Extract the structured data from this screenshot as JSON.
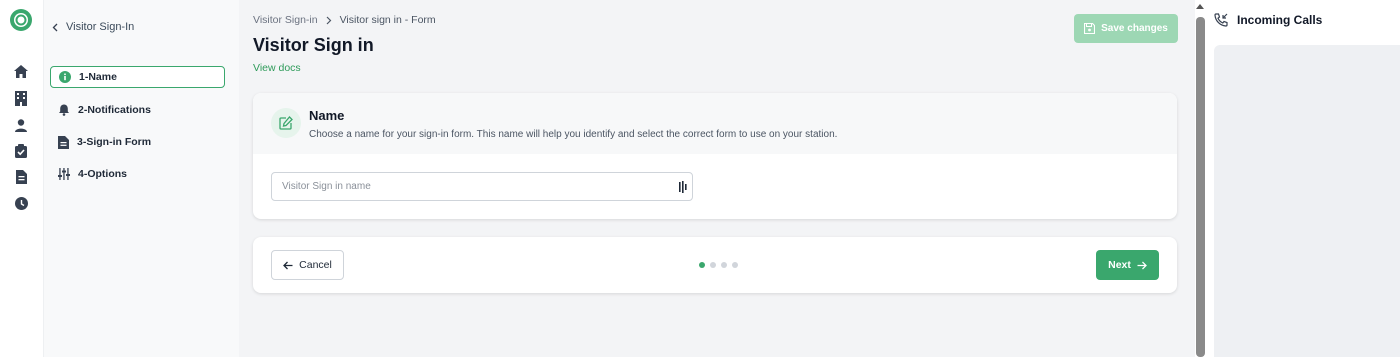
{
  "rail": {
    "icons": [
      "logo-icon",
      "home-icon",
      "building-icon",
      "person-icon",
      "clipboard-check-icon",
      "document-icon",
      "clock-icon"
    ]
  },
  "sidebar": {
    "back_label": "Visitor Sign-In",
    "steps": [
      {
        "label": "1-Name",
        "icon": "info-icon",
        "active": true
      },
      {
        "label": "2-Notifications",
        "icon": "bell-icon",
        "active": false
      },
      {
        "label": "3-Sign-in Form",
        "icon": "document-icon",
        "active": false
      },
      {
        "label": "4-Options",
        "icon": "sliders-icon",
        "active": false
      }
    ]
  },
  "header": {
    "breadcrumb": [
      "Visitor Sign-in",
      "Visitor sign in - Form"
    ],
    "title": "Visitor Sign in",
    "docs_link": "View docs",
    "save_label": "Save changes"
  },
  "name_card": {
    "title": "Name",
    "description": "Choose a name for your sign-in form. This name will help you identify and select the correct form to use on your station.",
    "input_value": "",
    "input_placeholder": "Visitor Sign in name"
  },
  "footer": {
    "cancel_label": "Cancel",
    "next_label": "Next",
    "steps_total": 4,
    "current_step": 1
  },
  "calls_panel": {
    "title": "Incoming Calls"
  },
  "colors": {
    "accent": "#3aa76d",
    "accent_disabled": "#9dd7b4",
    "link": "#2e9b5a"
  }
}
